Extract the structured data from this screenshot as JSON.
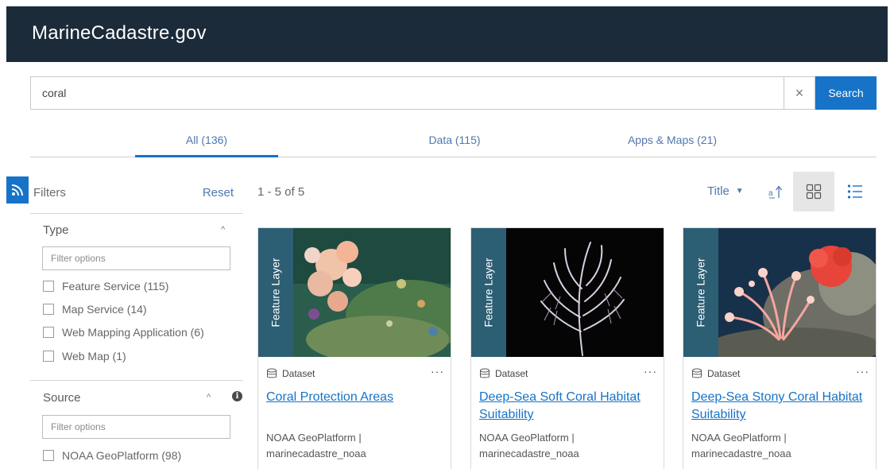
{
  "header": {
    "site_title": "MarineCadastre.gov"
  },
  "search": {
    "value": "coral",
    "placeholder": "",
    "clear_glyph": "×",
    "button_label": "Search"
  },
  "tabs": [
    {
      "label": "All (136)",
      "active": true
    },
    {
      "label": "Data (115)",
      "active": false
    },
    {
      "label": "Apps & Maps (21)",
      "active": false
    }
  ],
  "sidebar": {
    "filters_label": "Filters",
    "reset_label": "Reset",
    "type_section": {
      "title": "Type",
      "filter_placeholder": "Filter options",
      "options": [
        "Feature Service (115)",
        "Map Service (14)",
        "Web Mapping Application (6)",
        "Web Map (1)"
      ]
    },
    "source_section": {
      "title": "Source",
      "info_glyph": "i",
      "filter_placeholder": "Filter options",
      "options": [
        "NOAA GeoPlatform (98)"
      ]
    },
    "caret_glyph": "^"
  },
  "results": {
    "count_label": "1 - 5 of 5",
    "sort_label": "Title",
    "view_mode": "grid"
  },
  "cards": [
    {
      "type_band": "Feature Layer",
      "item_type": "Dataset",
      "title": "Coral Protection Areas",
      "owner": "NOAA GeoPlatform | marinecadastre_noaa"
    },
    {
      "type_band": "Feature Layer",
      "item_type": "Dataset",
      "title": "Deep-Sea Soft Coral Habitat Suitability",
      "owner": "NOAA GeoPlatform | marinecadastre_noaa"
    },
    {
      "type_band": "Feature Layer",
      "item_type": "Dataset",
      "title": "Deep-Sea Stony Coral Habitat Suitability",
      "owner": "NOAA GeoPlatform | marinecadastre_noaa"
    }
  ],
  "more_glyph": "···",
  "colors": {
    "header_bg": "#1c2b3a",
    "accent": "#1673c8",
    "type_band": "#2c5e74"
  },
  "icons": [
    "rss-icon",
    "close-icon",
    "chevron-up-icon",
    "info-icon",
    "chevron-down-icon",
    "sort-direction-icon",
    "grid-view-icon",
    "list-view-icon",
    "database-icon",
    "more-icon"
  ]
}
